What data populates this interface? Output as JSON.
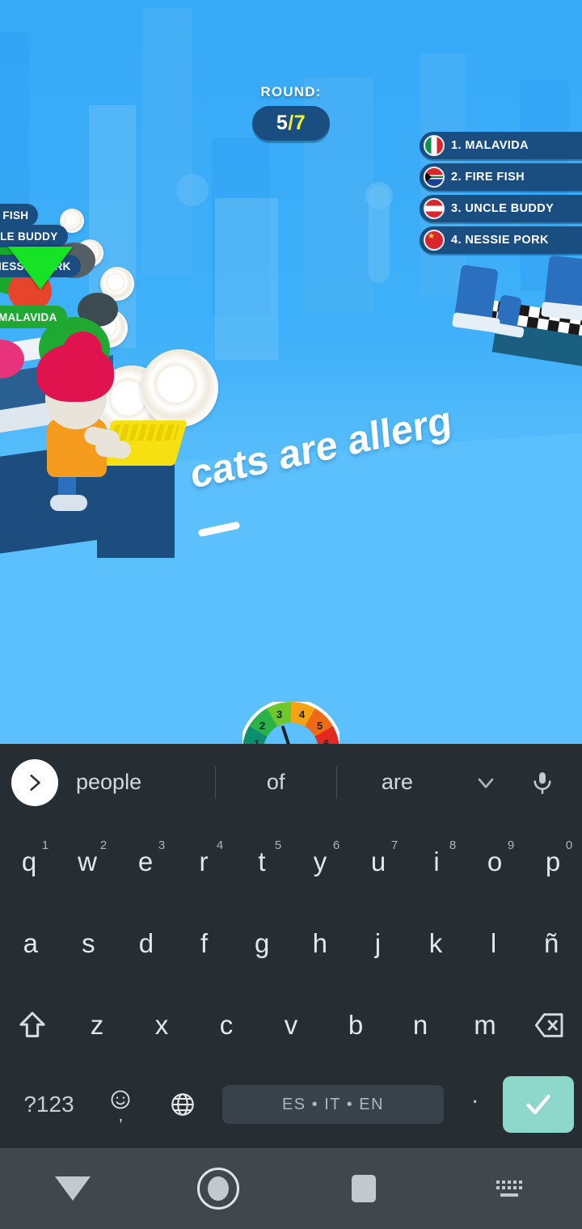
{
  "game": {
    "round_label": "ROUND:",
    "round_current": "5",
    "round_sep_total": "/7",
    "typed_sentence": "cats are allerg",
    "leaderboard": [
      {
        "rank": "1. MALAVIDA",
        "flag": "flag-italy-icon"
      },
      {
        "rank": "2. FIRE FISH",
        "flag": "flag-south-africa-icon"
      },
      {
        "rank": "3. UNCLE BUDDY",
        "flag": "flag-austria-icon"
      },
      {
        "rank": "4. NESSIE PORK",
        "flag": "flag-china-icon"
      }
    ],
    "world_tags": [
      {
        "label": "E FISH"
      },
      {
        "label": "NCLE BUDDY"
      },
      {
        "label": "NESSIE PORK"
      },
      {
        "label": "MALAVIDA"
      }
    ],
    "gauge": {
      "ticks": [
        "1",
        "2",
        "3",
        "4",
        "5",
        "6"
      ],
      "needle_value": "3"
    },
    "colors": {
      "sky": "#3fb0f9",
      "badge": "#1b4e80",
      "highlight_yellow": "#f4f135",
      "marker_green": "#17e326"
    }
  },
  "keyboard": {
    "suggestions": {
      "go_icon": "chevron-right-icon",
      "words": [
        "people",
        "of",
        "are"
      ],
      "expand_icon": "chevron-down-icon",
      "mic_icon": "microphone-icon"
    },
    "row1": [
      {
        "key": "q",
        "sup": "1"
      },
      {
        "key": "w",
        "sup": "2"
      },
      {
        "key": "e",
        "sup": "3"
      },
      {
        "key": "r",
        "sup": "4"
      },
      {
        "key": "t",
        "sup": "5"
      },
      {
        "key": "y",
        "sup": "6"
      },
      {
        "key": "u",
        "sup": "7"
      },
      {
        "key": "i",
        "sup": "8"
      },
      {
        "key": "o",
        "sup": "9"
      },
      {
        "key": "p",
        "sup": "0"
      }
    ],
    "row2": [
      "a",
      "s",
      "d",
      "f",
      "g",
      "h",
      "j",
      "k",
      "l",
      "ñ"
    ],
    "row3": {
      "shift_icon": "shift-icon",
      "keys": [
        "z",
        "x",
        "c",
        "v",
        "b",
        "n",
        "m"
      ],
      "backspace_icon": "backspace-icon"
    },
    "row4": {
      "symbols_label": "?123",
      "emoji_icon": "emoji-icon",
      "comma_label": ",",
      "globe_icon": "globe-icon",
      "space_label": "ES • IT • EN",
      "period_label": ".",
      "enter_icon": "checkmark-icon",
      "enter_color": "#8ed7cb"
    }
  },
  "navbar": {
    "back_icon": "hide-keyboard-triangle-icon",
    "home_icon": "home-circle-icon",
    "recents_icon": "recents-square-icon",
    "switch_keyboard_icon": "keyboard-switch-icon"
  }
}
